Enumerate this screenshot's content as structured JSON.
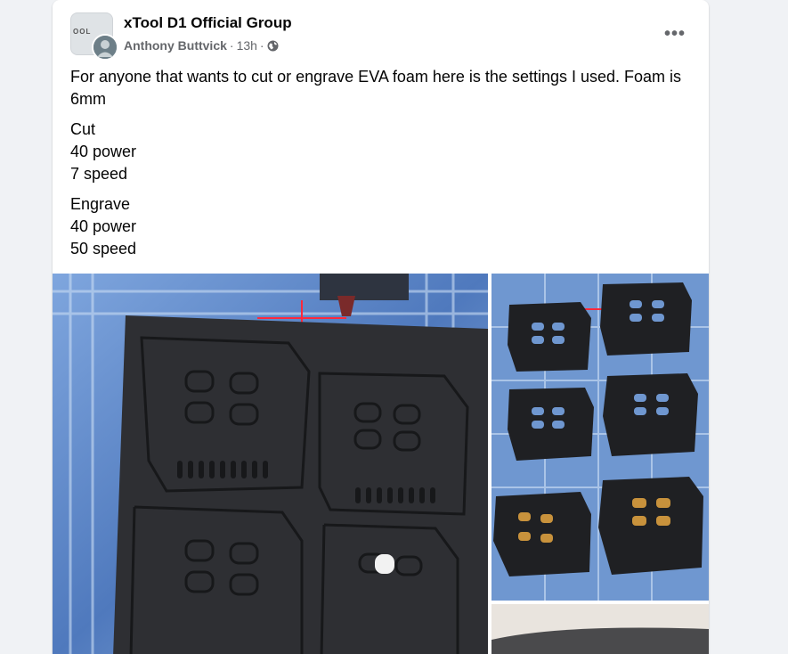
{
  "post": {
    "group_name": "xTool D1 Official Group",
    "author": "Anthony Buttvick",
    "separator": "·",
    "time": "13h",
    "visibility_icon": "globe-icon",
    "more_icon": "more-options-icon",
    "more_label": "•••",
    "avatar_text": "OOL",
    "body": {
      "intro": "For anyone that wants to cut or engrave EVA foam here is the settings I used.  Foam is 6mm",
      "cut": [
        "Cut",
        "40 power",
        "7 speed"
      ],
      "engrave": [
        "Engrave",
        "40 power",
        "50 speed"
      ]
    }
  },
  "photos": [
    {
      "name": "foam-sheet-photo"
    },
    {
      "name": "cut-pieces-photo"
    },
    {
      "name": "foam-closeup-photo"
    }
  ],
  "colors": {
    "text_primary": "#050505",
    "text_secondary": "#65676b",
    "laser_red": "#ff2a3c",
    "foam_black": "#2a2b2e",
    "bed_blue": "#5a86c9"
  }
}
